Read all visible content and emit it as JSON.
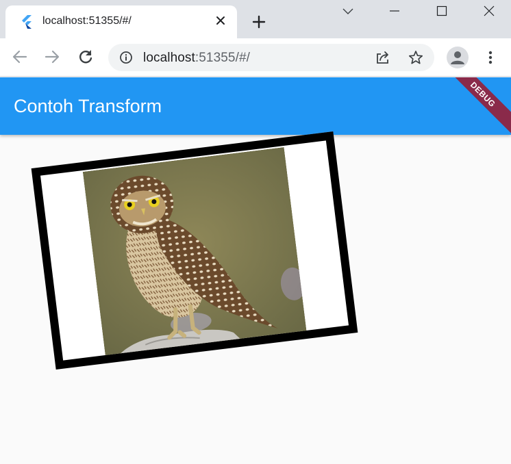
{
  "browser": {
    "tab_title": "localhost:51355/#/",
    "url_host": "localhost",
    "url_path": ":51355/#/"
  },
  "app": {
    "title": "Contoh Transform",
    "debug_label": "DEBUG",
    "appbar_color": "#2196f3",
    "image_subject": "owl"
  },
  "colors": {
    "frame_border": "#000000",
    "debug_banner": "#8a2a4a"
  }
}
